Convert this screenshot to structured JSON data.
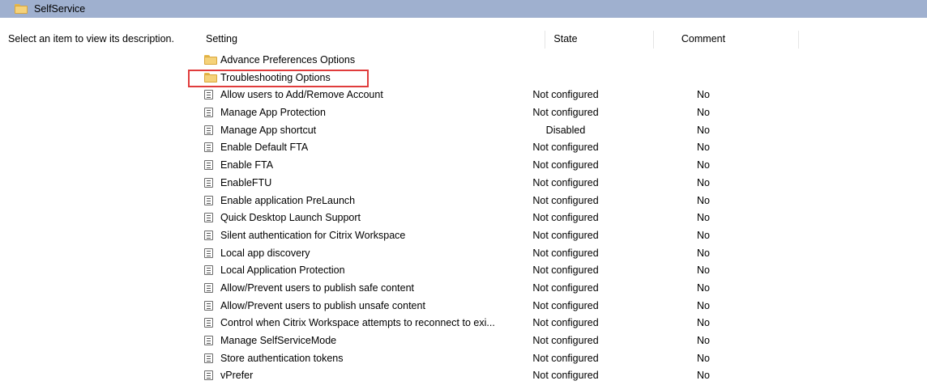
{
  "titlebar": {
    "title": "SelfService",
    "icon": "folder-icon"
  },
  "description": "Select an item to view its description.",
  "columns": {
    "setting": "Setting",
    "state": "State",
    "comment": "Comment"
  },
  "folders": [
    {
      "label": "Advance Preferences Options"
    },
    {
      "label": "Troubleshooting Options",
      "highlighted": true
    }
  ],
  "policies": [
    {
      "name": "Allow users to Add/Remove Account",
      "state": "Not configured",
      "comment": "No"
    },
    {
      "name": "Manage App Protection",
      "state": "Not configured",
      "comment": "No"
    },
    {
      "name": "Manage App shortcut",
      "state": "Disabled",
      "comment": "No"
    },
    {
      "name": "Enable Default FTA",
      "state": "Not configured",
      "comment": "No"
    },
    {
      "name": "Enable FTA",
      "state": "Not configured",
      "comment": "No"
    },
    {
      "name": "EnableFTU",
      "state": "Not configured",
      "comment": "No"
    },
    {
      "name": "Enable application PreLaunch",
      "state": "Not configured",
      "comment": "No"
    },
    {
      "name": "Quick Desktop Launch Support",
      "state": "Not configured",
      "comment": "No"
    },
    {
      "name": "Silent authentication for Citrix Workspace",
      "state": "Not configured",
      "comment": "No"
    },
    {
      "name": "Local app discovery",
      "state": "Not configured",
      "comment": "No"
    },
    {
      "name": "Local Application Protection",
      "state": "Not configured",
      "comment": "No"
    },
    {
      "name": "Allow/Prevent users to publish safe content",
      "state": "Not configured",
      "comment": "No"
    },
    {
      "name": "Allow/Prevent users to publish unsafe content",
      "state": "Not configured",
      "comment": "No"
    },
    {
      "name": "Control when Citrix Workspace attempts to reconnect to exi...",
      "state": "Not configured",
      "comment": "No"
    },
    {
      "name": "Manage SelfServiceMode",
      "state": "Not configured",
      "comment": "No"
    },
    {
      "name": "Store authentication tokens",
      "state": "Not configured",
      "comment": "No"
    },
    {
      "name": "vPrefer",
      "state": "Not configured",
      "comment": "No"
    }
  ],
  "colors": {
    "titlebar": "#9fb0cf",
    "highlight": "#e03c3c"
  }
}
